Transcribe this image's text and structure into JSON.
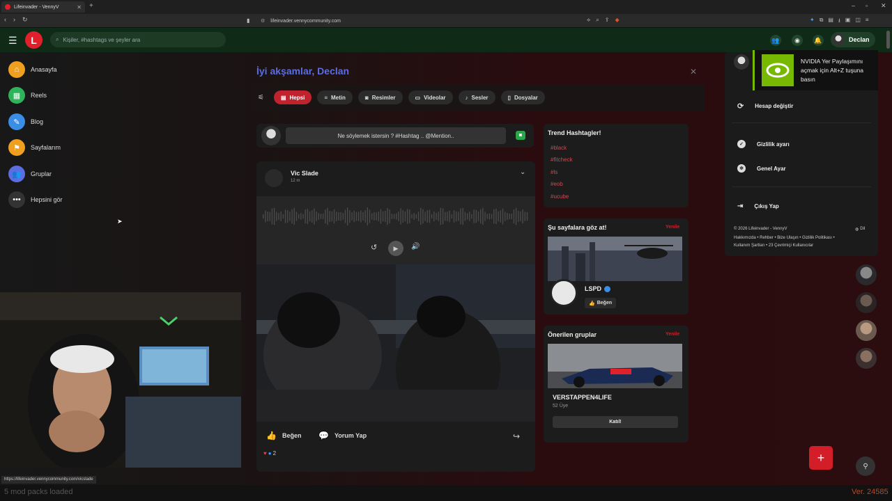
{
  "browser": {
    "tab_title": "Lifeinvader - VennyV",
    "url": "lifeinvader.vennycommunity.com",
    "status_link": "https://lifeinvader.vennycommunity.com/vicslade"
  },
  "header": {
    "search_placeholder": "Kişiler, #hashtags ve şeyler ara",
    "user_name": "Declan"
  },
  "sidebar": {
    "items": [
      {
        "label": "Anasayfa",
        "icon": "home-icon",
        "color": "#f0a020"
      },
      {
        "label": "Reels",
        "icon": "reels-icon",
        "color": "#2fb35a"
      },
      {
        "label": "Blog",
        "icon": "blog-icon",
        "color": "#3a8ee6"
      },
      {
        "label": "Sayfalarım",
        "icon": "flag-icon",
        "color": "#f0a020"
      },
      {
        "label": "Gruplar",
        "icon": "groups-icon",
        "color": "#5b6de0"
      },
      {
        "label": "Hepsini gör",
        "icon": "more-icon",
        "color": "#333333"
      }
    ]
  },
  "main": {
    "greeting": "İyi akşamlar, Declan",
    "filters": [
      {
        "label": "Hepsi",
        "active": true
      },
      {
        "label": "Metin"
      },
      {
        "label": "Resimler"
      },
      {
        "label": "Videolar"
      },
      {
        "label": "Sesler"
      },
      {
        "label": "Dosyalar"
      }
    ],
    "composer_placeholder": "Ne söylemek istersin ? #Hashtag .. @Mention..",
    "post": {
      "author": "Vic Slade",
      "time": "12 m",
      "like_label": "Beğen",
      "comment_label": "Yorum Yap",
      "reaction_count": "2"
    }
  },
  "right": {
    "trending_title": "Trend Hashtagler!",
    "hashtags": [
      "#black",
      "#fitcheck",
      "#ls",
      "#eob",
      "#ucube"
    ],
    "pages_title": "Şu sayfalara göz at!",
    "refresh_label": "Yenile",
    "page_name": "LSPD",
    "page_like": "Beğen",
    "groups_title": "Önerilen gruplar",
    "group_name": "VERSTAPPEN4LIFE",
    "group_members": "52 Üye",
    "join_label": "Katıl!"
  },
  "dropdown": {
    "items": [
      "Hesap değiştir",
      "Gizlilik ayarı",
      "Genel Ayar",
      "Çıkış Yap"
    ],
    "footer_copy": "© 2026 Lifeinvader - VennyV",
    "lang": "Dil",
    "footer_links": "Hakkımızda • Rehber • Bize Ulaşın • Gizlilik Politikası •",
    "footer_links2": "Kullanım Şartları • 23 Çevrimiçi Kullanıcılar"
  },
  "toast": {
    "text": "NVIDIA Yer Paylaşımını açmak için Alt+Z tuşuna basın"
  },
  "bottom": {
    "left": "5 mod packs loaded",
    "right": "Ver. 24585"
  }
}
